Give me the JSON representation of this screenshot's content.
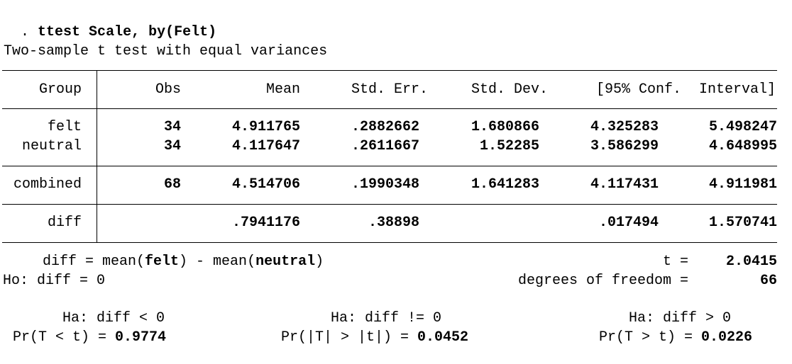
{
  "command": {
    "prompt": ".",
    "text": "ttest Scale, by(Felt)"
  },
  "title": "Two-sample t test with equal variances",
  "table": {
    "headers": [
      "Group",
      "Obs",
      "Mean",
      "Std. Err.",
      "Std. Dev.",
      "[95% Conf.",
      "Interval]"
    ],
    "rows": [
      {
        "group": "felt",
        "obs": "34",
        "mean": "4.911765",
        "se": ".2882662",
        "sd": "1.680866",
        "lo": "4.325283",
        "hi": "5.498247"
      },
      {
        "group": "neutral",
        "obs": "34",
        "mean": "4.117647",
        "se": ".2611667",
        "sd": "1.52285",
        "lo": "3.586299",
        "hi": "4.648995"
      },
      {
        "group": "combined",
        "obs": "68",
        "mean": "4.514706",
        "se": ".1990348",
        "sd": "1.641283",
        "lo": "4.117431",
        "hi": "4.911981"
      },
      {
        "group": "diff",
        "obs": "",
        "mean": ".7941176",
        "se": ".38898",
        "sd": "",
        "lo": ".017494",
        "hi": "1.570741"
      }
    ]
  },
  "stats": {
    "diff_prefix": "diff = mean(",
    "diff_g1": "felt",
    "diff_mid": ") - mean(",
    "diff_g2": "neutral",
    "diff_suffix": ")",
    "t_label": "t =",
    "t_value": "2.0415",
    "ho": "Ho: diff = 0",
    "df_label": "degrees of freedom =",
    "df_value": "66"
  },
  "hypotheses": {
    "lt": {
      "ha": "Ha: diff < 0",
      "pr_label": "Pr(T < t) =",
      "pr_value": "0.9774"
    },
    "ne": {
      "ha": "Ha: diff != 0",
      "pr_label": "Pr(|T| > |t|) =",
      "pr_value": "0.0452"
    },
    "gt": {
      "ha": "Ha: diff > 0",
      "pr_label": "Pr(T > t) =",
      "pr_value": "0.0226"
    }
  }
}
